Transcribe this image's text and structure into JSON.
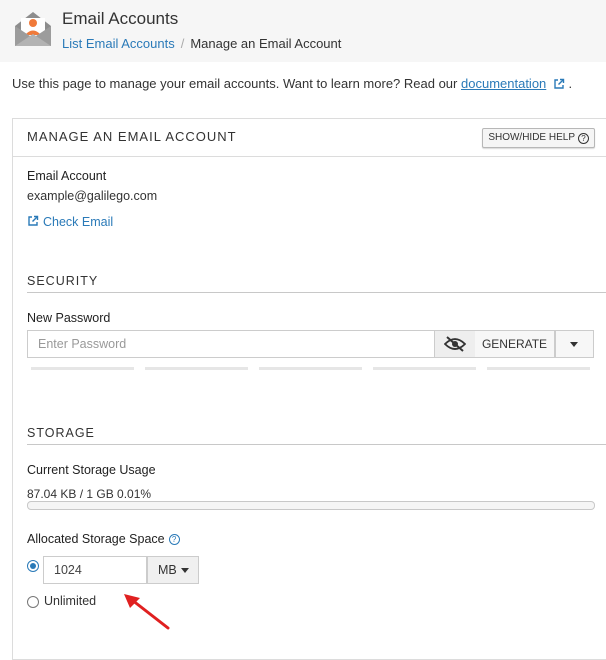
{
  "header": {
    "title": "Email Accounts",
    "breadcrumb": {
      "parent": "List Email Accounts",
      "separator": "/",
      "current": "Manage an Email Account"
    }
  },
  "intro": {
    "text": "Use this page to manage your email accounts. Want to learn more? Read our",
    "link": "documentation",
    "suffix": "."
  },
  "panel": {
    "title": "MANAGE AN EMAIL ACCOUNT",
    "help_button": "SHOW/HIDE HELP",
    "help_glyph": "?"
  },
  "account": {
    "label": "Email Account",
    "address": "example@galilego.com",
    "check_email": "Check Email"
  },
  "security": {
    "title": "SECURITY",
    "new_password_label": "New Password",
    "password_placeholder": "Enter Password",
    "generate_label": "GENERATE"
  },
  "storage": {
    "title": "STORAGE",
    "usage_label": "Current Storage Usage",
    "usage_value": "87.04 KB / 1 GB 0.01%",
    "usage_percent": 0.01,
    "allocated_label": "Allocated Storage Space",
    "help_glyph": "?",
    "quota_value": "1024",
    "unit": "MB",
    "unlimited_label": "Unlimited"
  },
  "colors": {
    "link": "#2a7ab8",
    "accent_icon": "#f07a3a",
    "arrow": "#e02020"
  }
}
